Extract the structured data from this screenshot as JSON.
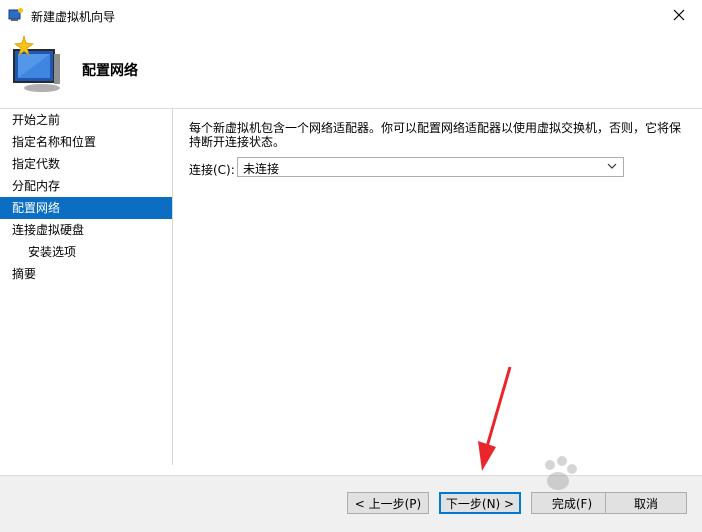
{
  "window": {
    "title": "新建虚拟机向导"
  },
  "header": {
    "title": "配置网络"
  },
  "sidebar": {
    "items": [
      {
        "label": "开始之前"
      },
      {
        "label": "指定名称和位置"
      },
      {
        "label": "指定代数"
      },
      {
        "label": "分配内存"
      },
      {
        "label": "配置网络"
      },
      {
        "label": "连接虚拟硬盘"
      },
      {
        "label": "安装选项"
      },
      {
        "label": "摘要"
      }
    ],
    "active_index": 4
  },
  "main": {
    "description": "每个新虚拟机包含一个网络适配器。你可以配置网络适配器以使用虚拟交换机，否则，它将保持断开连接状态。",
    "connection": {
      "label": "连接(C):",
      "value": "未连接"
    }
  },
  "footer": {
    "prev_label": "< 上一步(P)",
    "next_label": "下一步(N) >",
    "finish_label": "完成(F)",
    "cancel_label": "取消"
  },
  "colors": {
    "accent": "#0b6ec3",
    "annotation": "#e8262b"
  }
}
